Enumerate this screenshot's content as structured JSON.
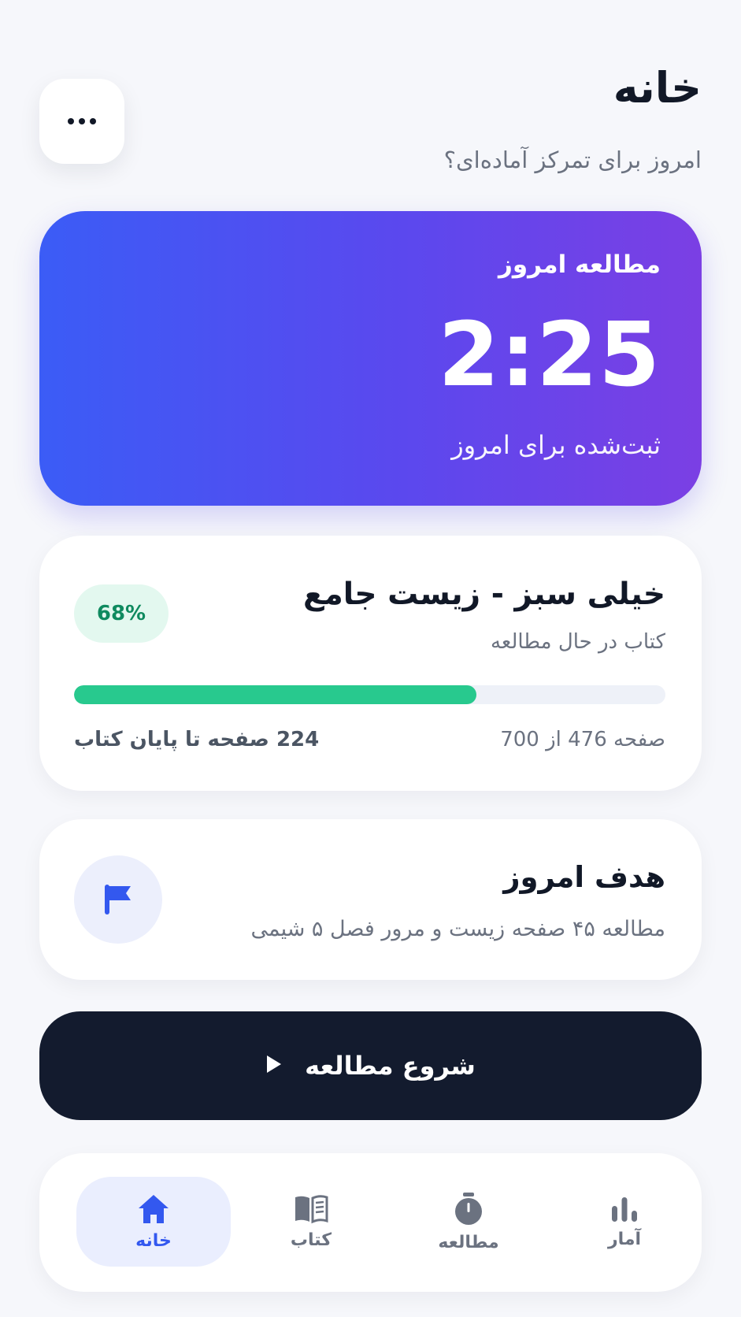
{
  "header": {
    "title": "خانه",
    "subtitle": "امروز برای تمرکز آماده‌ای؟",
    "menu_icon": "more-horizontal-icon"
  },
  "today_study": {
    "label": "مطالعه امروز",
    "time": "2:25",
    "caption": "ثبت‌شده برای امروز",
    "gradient": [
      "#3b5cf6",
      "#7b3fe4"
    ]
  },
  "current_book": {
    "title": "خیلی سبز - زیست جامع",
    "subtitle": "کتاب در حال مطالعه",
    "percent_label": "68%",
    "progress": 0.68,
    "page_status": "صفحه 476 از 700",
    "pages_left": "224 صفحه تا پایان کتاب",
    "progress_color": "#28c98e"
  },
  "goal": {
    "title": "هدف امروز",
    "description": "مطالعه ۴۵ صفحه زیست و مرور فصل ۵ شیمی",
    "icon": "flag-icon"
  },
  "start_button": {
    "label": "شروع مطالعه",
    "icon": "play-icon"
  },
  "nav": {
    "items": [
      {
        "label": "خانه",
        "icon": "home-icon",
        "active": true
      },
      {
        "label": "کتاب",
        "icon": "book-icon",
        "active": false
      },
      {
        "label": "مطالعه",
        "icon": "timer-icon",
        "active": false
      },
      {
        "label": "آمار",
        "icon": "bar-chart-icon",
        "active": false
      }
    ],
    "accent": "#3358ef"
  }
}
